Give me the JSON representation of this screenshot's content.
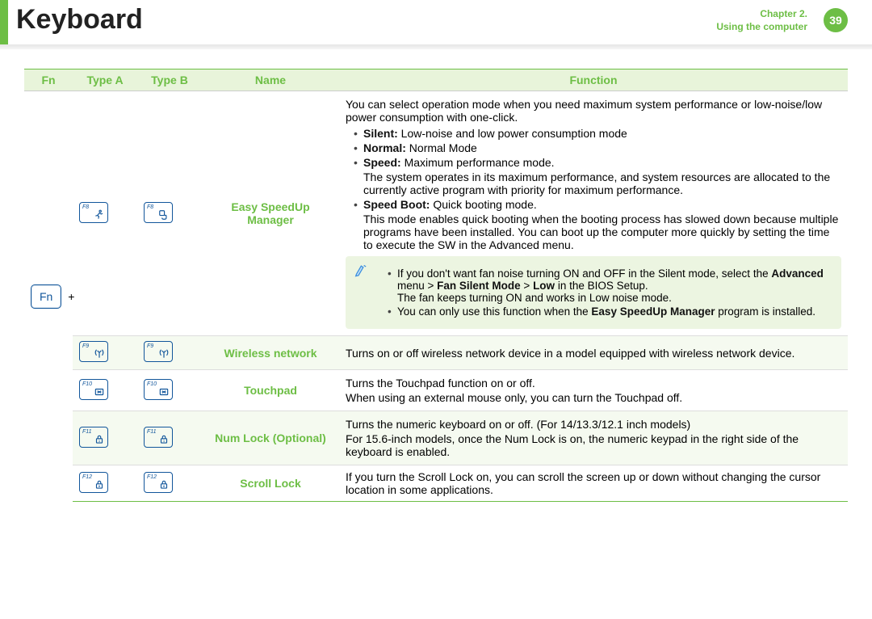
{
  "header": {
    "title": "Keyboard",
    "chapter_line1": "Chapter 2.",
    "chapter_line2": "Using the computer",
    "page_number": "39"
  },
  "table": {
    "headers": {
      "fn": "Fn",
      "typeA": "Type A",
      "typeB": "Type B",
      "name": "Name",
      "function": "Function"
    },
    "fn_key": {
      "label": "Fn",
      "plus": "+"
    },
    "rows": [
      {
        "key_label_a": "F8",
        "key_label_b": "F8",
        "icon": "speed",
        "name": "Easy SpeedUp Manager",
        "function": {
          "intro": "You can select operation mode when you need maximum system performance or low-noise/low power consumption with one-click.",
          "bullets": [
            {
              "b": "Silent:",
              "t": " Low-noise and low power consumption mode"
            },
            {
              "b": "Normal:",
              "t": "  Normal Mode"
            },
            {
              "b": "Speed:",
              "t": "  Maximum performance mode.",
              "sub": "The system operates in its maximum performance, and system resources are allocated to the currently active program with priority for maximum performance."
            },
            {
              "b": "Speed Boot:",
              "t": "  Quick booting mode.",
              "sub": "This mode enables quick booting when the booting process has slowed down because multiple programs have been installed. You can boot up the computer more quickly by setting the time to execute the SW in the Advanced menu."
            }
          ],
          "note_bullet1_pre": "If you don't want fan noise turning ON and OFF in the Silent mode, select the ",
          "note_bullet1_b": "Advanced",
          "note_bullet1_mid": " menu > ",
          "note_bullet1_b2": "Fan Silent Mode",
          "note_bullet1_mid2": " > ",
          "note_bullet1_b3": "Low",
          "note_bullet1_post": " in the BIOS Setup.",
          "note_bullet1_line2": "The fan keeps turning ON and works in Low noise mode.",
          "note_bullet2_pre": "You can only use this function when the ",
          "note_bullet2_b": "Easy SpeedUp Manager",
          "note_bullet2_post": " program is installed."
        }
      },
      {
        "key_label_a": "F9",
        "key_label_b": "F9",
        "icon": "wifi",
        "name": "Wireless network",
        "alt": true,
        "function": {
          "text": "Turns on or off wireless network device in a model equipped with wireless network device."
        }
      },
      {
        "key_label_a": "F10",
        "key_label_b": "F10",
        "icon": "touchpad",
        "name": "Touchpad",
        "function": {
          "p1": "Turns the Touchpad function on or off.",
          "p2": "When using an external mouse only, you can turn the Touchpad off."
        }
      },
      {
        "key_label_a": "F11",
        "key_label_b": "F11",
        "icon": "numlock",
        "name": "Num Lock (Optional)",
        "alt": true,
        "function": {
          "p1": "Turns the numeric keyboard on or off. (For 14/13.3/12.1 inch models)",
          "p2": "For 15.6-inch models, once the Num Lock is on, the numeric keypad in the right side of the keyboard is enabled."
        }
      },
      {
        "key_label_a": "F12",
        "key_label_b": "F12",
        "icon": "scroll",
        "name": "Scroll Lock",
        "function": {
          "text": "If you turn the Scroll Lock on, you can scroll the screen up or down without changing the cursor location in some applications."
        }
      }
    ]
  }
}
